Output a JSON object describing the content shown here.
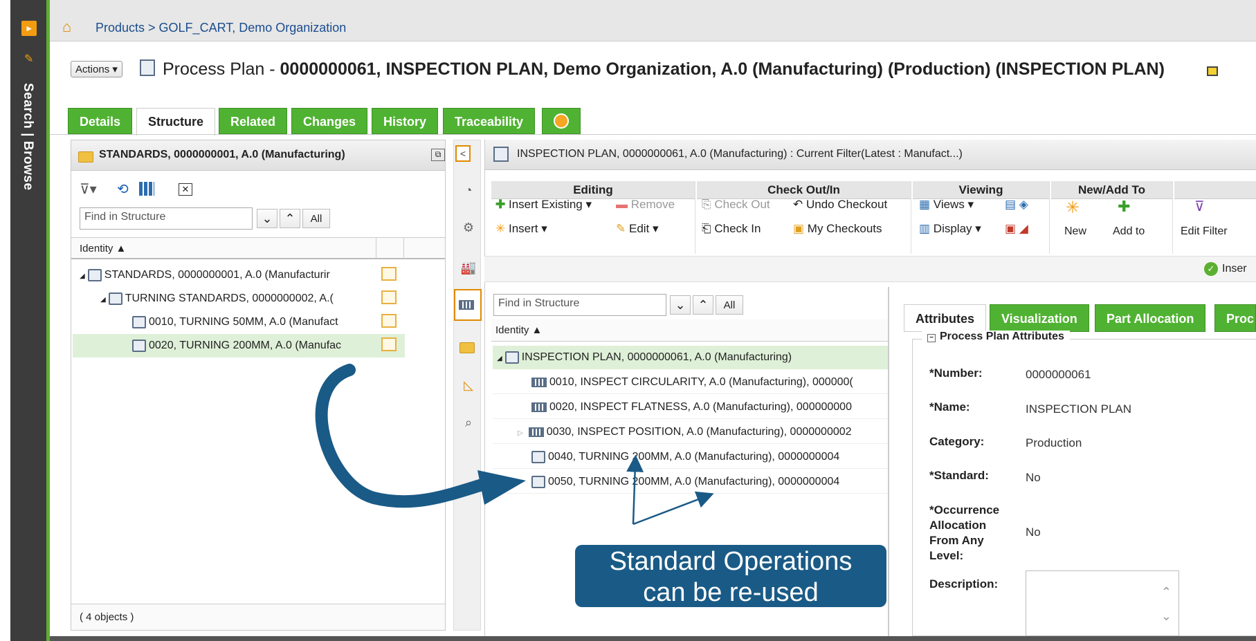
{
  "nav": {
    "side_label": "Search | Browse"
  },
  "breadcrumb": {
    "text": "Products > GOLF_CART, Demo Organization"
  },
  "title": {
    "actions_label": "Actions ▾",
    "prefix": "Process Plan - ",
    "main": "0000000061, INSPECTION PLAN, Demo Organization, A.0 (Manufacturing) (Production) (INSPECTION PLAN)"
  },
  "tabs": [
    "Details",
    "Structure",
    "Related",
    "Changes",
    "History",
    "Traceability"
  ],
  "left_panel": {
    "title": "STANDARDS, 0000000001, A.0 (Manufacturing)",
    "find_placeholder": "Find in Structure",
    "all_label": "All",
    "col_identity": "Identity ▲",
    "rows": [
      "STANDARDS, 0000000001, A.0 (Manufacturir",
      "TURNING STANDARDS, 0000000002, A.(",
      "0010, TURNING 50MM, A.0 (Manufact",
      "0020, TURNING 200MM, A.0 (Manufac"
    ],
    "footer": "( 4 objects )"
  },
  "right_panel": {
    "title": "INSPECTION PLAN, 0000000061, A.0 (Manufacturing) : Current Filter(Latest : Manufact...)",
    "toolbar": {
      "editing": "Editing",
      "checkout": "Check Out/In",
      "viewing": "Viewing",
      "newadd": "New/Add To",
      "insert_existing": "Insert Existing ▾",
      "remove": "Remove",
      "insert": "Insert ▾",
      "edit": "Edit ▾",
      "check_out": "Check Out",
      "undo_checkout": "Undo Checkout",
      "check_in": "Check In",
      "my_checkouts": "My Checkouts",
      "views": "Views ▾",
      "display": "Display ▾",
      "new": "New",
      "add_to": "Add to",
      "edit_filter": "Edit Filter"
    },
    "status": "Inser",
    "find_placeholder": "Find in Structure",
    "all_label": "All",
    "col_identity": "Identity ▲",
    "rows": [
      "INSPECTION PLAN, 0000000061, A.0 (Manufacturing)",
      "0010, INSPECT CIRCULARITY, A.0 (Manufacturing), 000000(",
      "0020, INSPECT FLATNESS, A.0 (Manufacturing), 000000000",
      "0030, INSPECT POSITION, A.0 (Manufacturing), 0000000002",
      "0040, TURNING 200MM, A.0 (Manufacturing), 0000000004",
      "0050, TURNING 200MM, A.0 (Manufacturing), 0000000004"
    ]
  },
  "attributes": {
    "tabs": [
      "Attributes",
      "Visualization",
      "Part Allocation",
      "Proc"
    ],
    "section": "Process Plan Attributes",
    "number_label": "*Number:",
    "number": "0000000061",
    "name_label": "*Name:",
    "name": "INSPECTION PLAN",
    "category_label": "Category:",
    "category": "Production",
    "standard_label": "*Standard:",
    "standard": "No",
    "occ_label_1": "*Occurrence",
    "occ_label_2": "Allocation",
    "occ_label_3": "From Any",
    "occ_label_4": "Level:",
    "occ": "No",
    "desc_label": "Description:"
  },
  "callout": {
    "line1": "Standard Operations",
    "line2": "can be re-used"
  },
  "colors": {
    "green": "#50b232",
    "callout": "#1a5a86",
    "link": "#1a4d8f"
  }
}
